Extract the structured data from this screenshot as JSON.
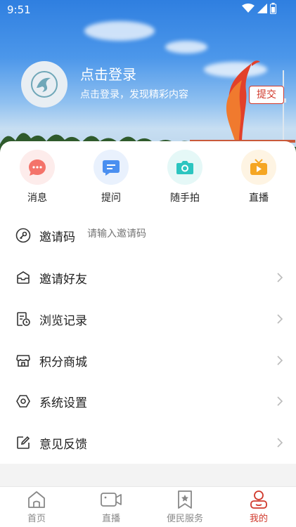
{
  "status_bar": {
    "time": "9:51"
  },
  "profile": {
    "title": "点击登录",
    "subtitle": "点击登录，发现精彩内容"
  },
  "quick_actions": [
    {
      "label": "消息",
      "icon": "message-icon",
      "color": "#f4736a"
    },
    {
      "label": "提问",
      "icon": "question-icon",
      "color": "#4a8ff0"
    },
    {
      "label": "随手拍",
      "icon": "camera-icon",
      "color": "#2cc5c0"
    },
    {
      "label": "直播",
      "icon": "tv-icon",
      "color": "#f5a623"
    }
  ],
  "invite": {
    "label": "邀请码",
    "placeholder": "请输入邀请码",
    "submit": "提交"
  },
  "menu": [
    {
      "label": "邀请好友",
      "icon": "invite-friend-icon"
    },
    {
      "label": "浏览记录",
      "icon": "history-icon"
    },
    {
      "label": "积分商城",
      "icon": "store-icon"
    },
    {
      "label": "系统设置",
      "icon": "settings-icon"
    },
    {
      "label": "意见反馈",
      "icon": "feedback-icon"
    }
  ],
  "bottom_nav": [
    {
      "label": "首页",
      "icon": "home-icon"
    },
    {
      "label": "直播",
      "icon": "video-icon"
    },
    {
      "label": "便民服务",
      "icon": "bookmark-star-icon"
    },
    {
      "label": "我的",
      "icon": "user-icon",
      "active": true
    }
  ],
  "colors": {
    "accent": "#d0382b",
    "banner": "#3b8ae6"
  }
}
